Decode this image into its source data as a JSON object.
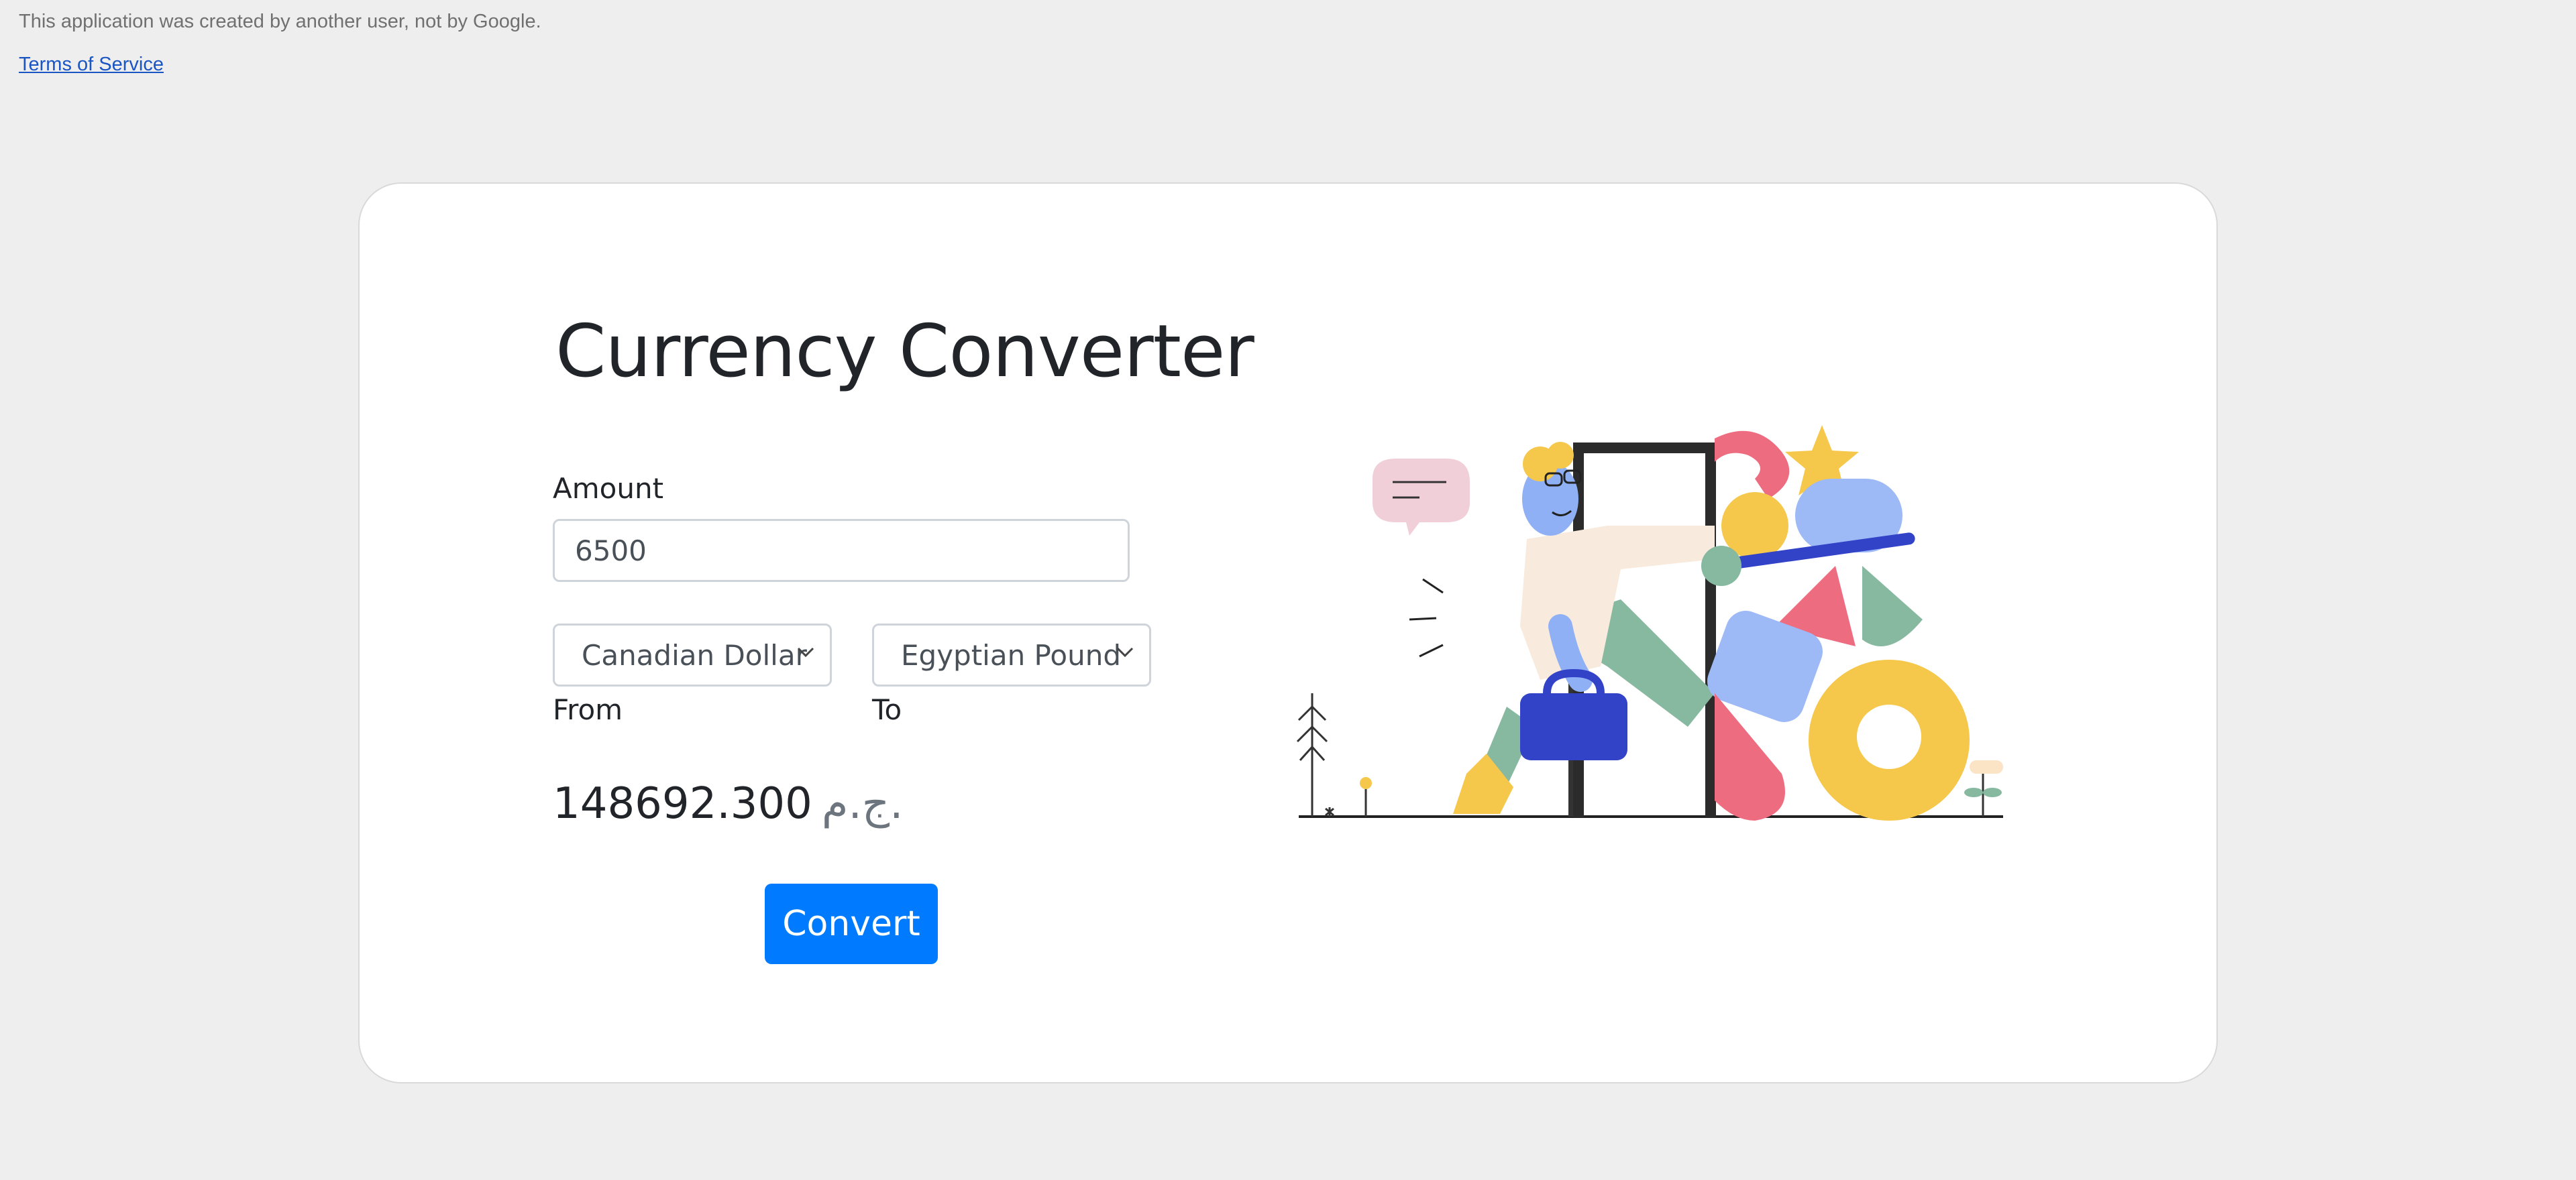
{
  "notice": {
    "text": "This application was created by another user, not by Google.",
    "terms_link": "Terms of Service"
  },
  "converter": {
    "title": "Currency Converter",
    "amount_label": "Amount",
    "amount_value": "6500",
    "from_currency": "Canadian Dollar",
    "to_currency": "Egyptian Pound",
    "from_label": "From",
    "to_label": "To",
    "result_value": "148692.300",
    "result_symbol": "ج.م.",
    "convert_label": "Convert"
  },
  "icons": {
    "select_arrow": "chevron-down-icon",
    "illustration": "person-walking-through-door-illustration"
  },
  "colors": {
    "accent": "#007bff",
    "background": "#eeeeee",
    "card": "#ffffff"
  }
}
